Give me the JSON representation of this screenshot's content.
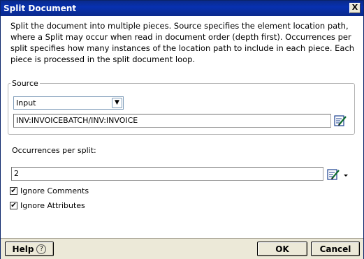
{
  "window": {
    "title": "Split Document",
    "close_label": "X"
  },
  "description": "Split the document into multiple pieces. Source specifies the element location path, where a Split may occur when read in document order (depth first). Occurrences per split specifies how many instances of the location path to include in each piece. Each piece is processed in the split document loop.",
  "source": {
    "legend": "Source",
    "select_value": "Input",
    "path_value": "INV:INVOICEBATCH/INV:INVOICE"
  },
  "occurrences": {
    "label": "Occurrences per split:",
    "value": "2"
  },
  "options": {
    "ignore_comments_label": "Ignore Comments",
    "ignore_comments_checked": true,
    "ignore_attributes_label": "Ignore Attributes",
    "ignore_attributes_checked": true
  },
  "footer": {
    "help_label": "Help",
    "help_icon": "?",
    "ok_label": "OK",
    "cancel_label": "Cancel"
  }
}
